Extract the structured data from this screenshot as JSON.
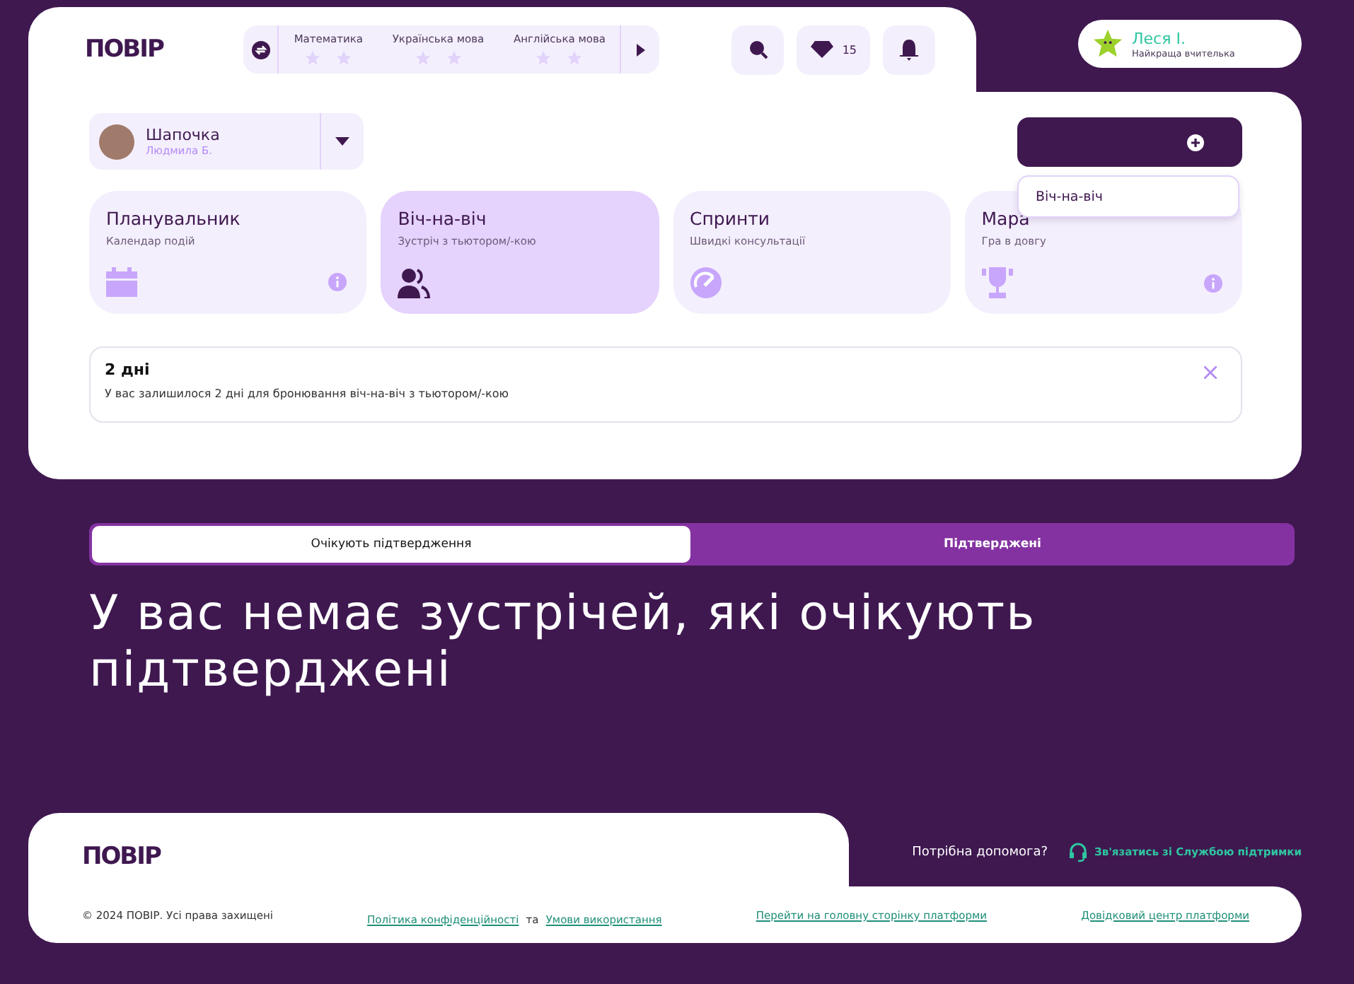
{
  "logo": "ПОВІР",
  "subjects": [
    {
      "name": "Математика"
    },
    {
      "name": "Українська мова"
    },
    {
      "name": "Англійська мова"
    }
  ],
  "gems": "15",
  "user": {
    "name": "Леся І.",
    "title": "Найкраща вчителька"
  },
  "student": {
    "name": "Шапочка",
    "teacher": "Людмила Б."
  },
  "menu": {
    "items": [
      "Віч-на-віч"
    ]
  },
  "cards": [
    {
      "title": "Планувальник",
      "subtitle": "Календар подій",
      "selected": false,
      "info": true
    },
    {
      "title": "Віч-на-віч",
      "subtitle": "Зустріч з тьютором/-кою",
      "selected": true,
      "info": false
    },
    {
      "title": "Спринти",
      "subtitle": "Швидкі консультації",
      "selected": false,
      "info": false
    },
    {
      "title": "Мара",
      "subtitle": "Гра в довгу",
      "selected": false,
      "info": true
    }
  ],
  "notice": {
    "title": "2 дні",
    "text": "У вас залишилося 2 дні для бронювання віч-на-віч з тьютором/-кою"
  },
  "tabs": [
    {
      "label": "Очікують підтвердження",
      "selected": true
    },
    {
      "label": "Підтверджені",
      "selected": false
    }
  ],
  "empty_message": "У вас немає зустрічей, які очікують підтверджені",
  "footer": {
    "logo": "ПОВІР",
    "help": "Потрібна допомога?",
    "support": "Зв'язатись зі Службою підтримки",
    "copyright": "© 2024 ПОВІР. Усі права захищені",
    "privacy": "Політика конфіденційності",
    "and": "та",
    "terms": "Умови використання",
    "home": "Перейти на головну сторінку платформи",
    "help_center": "Довідковий центр платформи"
  }
}
